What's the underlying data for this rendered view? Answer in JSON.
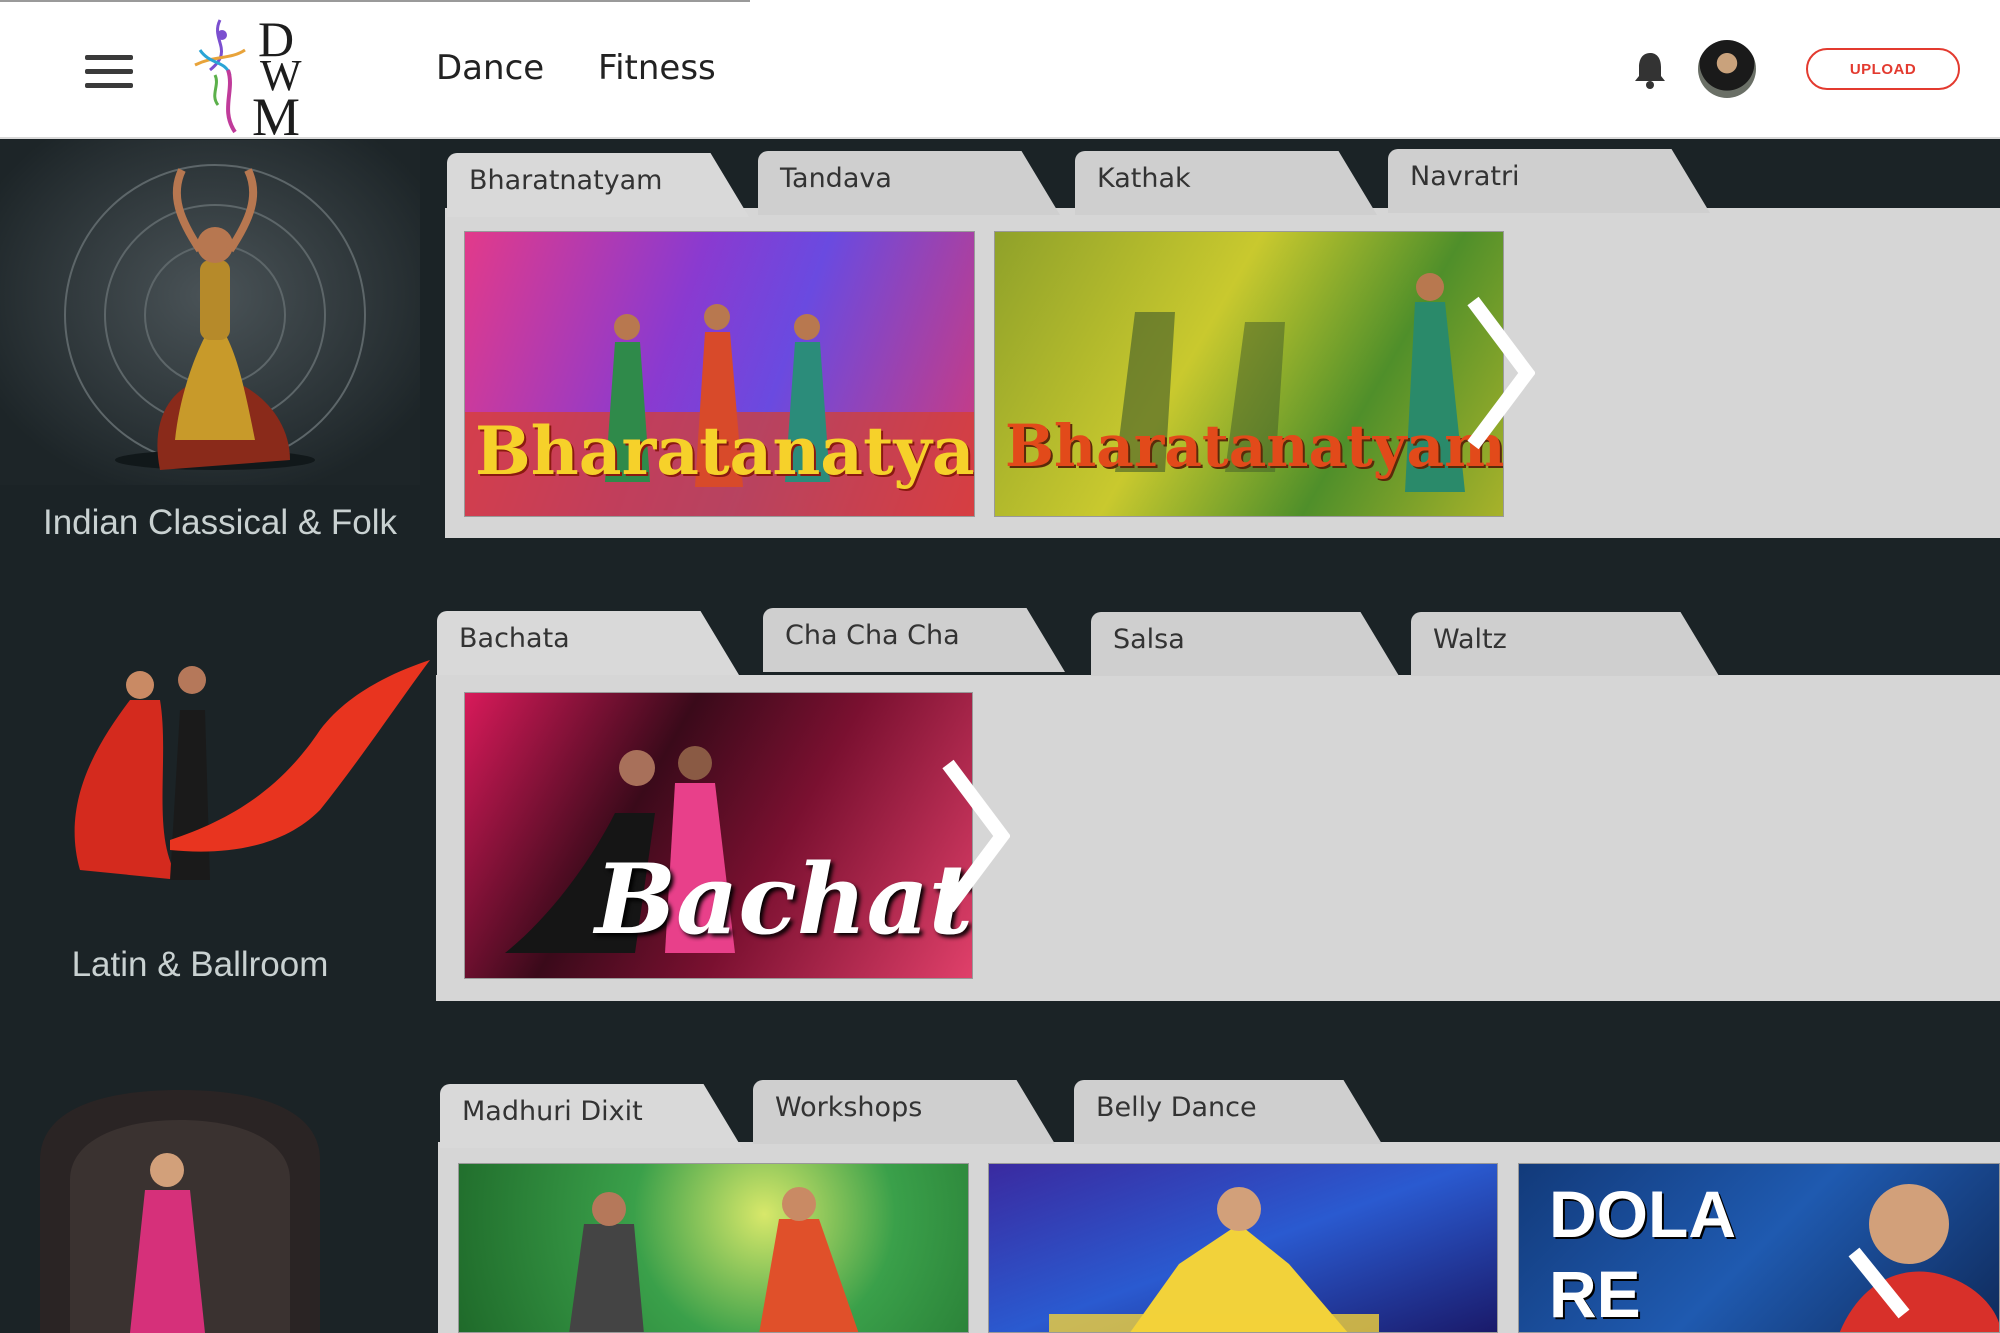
{
  "header": {
    "logo_letters": [
      "D",
      "W",
      "M"
    ],
    "nav": [
      {
        "label": "Dance"
      },
      {
        "label": "Fitness"
      }
    ],
    "upload_label": "UPLOAD",
    "icons": {
      "menu": "hamburger-icon",
      "notifications": "bell-icon"
    }
  },
  "categories": [
    {
      "label": "Indian Classical & Folk",
      "tabs": [
        "Bharatnatyam",
        "Tandava",
        "Kathak",
        "Navratri"
      ],
      "active_tab": "Bharatnatyam",
      "thumbnails": [
        {
          "title": "Bharatanatyam"
        },
        {
          "title": "Bharatanatyam"
        }
      ]
    },
    {
      "label": "Latin & Ballroom",
      "tabs": [
        "Bachata",
        "Cha Cha Cha",
        "Salsa",
        "Waltz"
      ],
      "active_tab": "Bachata",
      "thumbnails": [
        {
          "title": "Bachata"
        }
      ]
    },
    {
      "label": "",
      "tabs": [
        "Madhuri Dixit",
        "Workshops",
        "Belly Dance"
      ],
      "active_tab": "Madhuri Dixit",
      "thumbnails": [
        {
          "title": ""
        },
        {
          "title": ""
        },
        {
          "title": "DOLA RE"
        }
      ]
    }
  ],
  "colors": {
    "background": "#1b2326",
    "panel": "#d6d6d6",
    "upload_accent": "#e33a2f",
    "category_label": "#c9d1d1"
  }
}
